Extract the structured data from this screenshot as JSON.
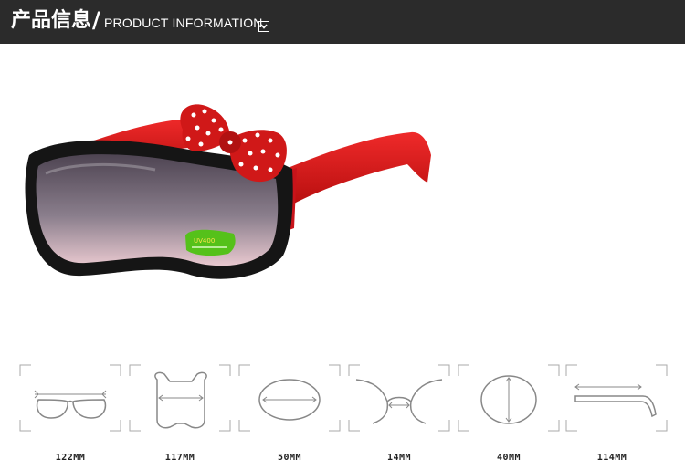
{
  "header": {
    "title_cn": "产品信息",
    "separator": "/",
    "title_en": "PRODUCT INFORMATION",
    "icon": "chevron-down-icon"
  },
  "product": {
    "frame_color": "#111111",
    "temple_color": "#d11a1a",
    "bow_color": "#d01818",
    "bow_dots_color": "#ffffff",
    "lens_color": "#6c5e6e"
  },
  "dimensions": [
    {
      "label": "122MM",
      "icon": "frame-width-icon"
    },
    {
      "label": "117MM",
      "icon": "frame-inner-width-icon"
    },
    {
      "label": "50MM",
      "icon": "lens-width-icon"
    },
    {
      "label": "14MM",
      "icon": "bridge-width-icon"
    },
    {
      "label": "40MM",
      "icon": "lens-height-icon"
    },
    {
      "label": "114MM",
      "icon": "temple-length-icon"
    }
  ]
}
